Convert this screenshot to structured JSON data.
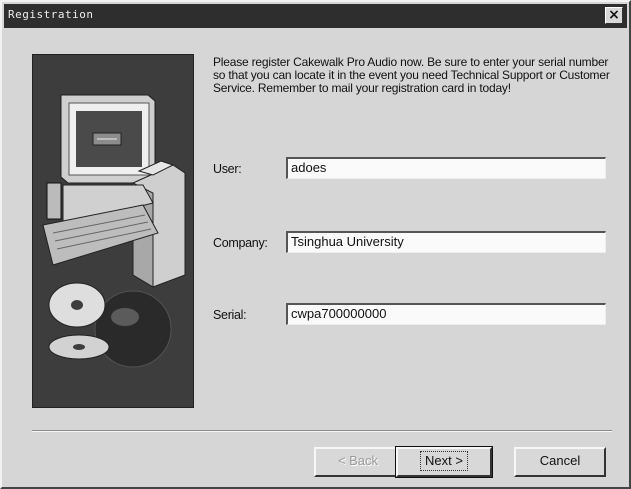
{
  "window": {
    "title": "Registration",
    "close_label": "×"
  },
  "intro_text": "Please register Cakewalk Pro Audio now.  Be sure to enter your serial number so that you can locate it in the event you need Technical Support or Customer Service.  Remember to mail your registration card in today!",
  "fields": {
    "user": {
      "label": "User:",
      "value": "adoes"
    },
    "company": {
      "label": "Company:",
      "value": "Tsinghua University"
    },
    "serial": {
      "label": "Serial:",
      "value": "cwpa700000000"
    }
  },
  "buttons": {
    "back": {
      "label": "< Back",
      "enabled": false
    },
    "next": {
      "label": "Next >",
      "enabled": true
    },
    "cancel": {
      "label": "Cancel",
      "enabled": true
    }
  },
  "colors": {
    "titlebar": "#2e2e2e",
    "dialog_face": "#d6d6d6",
    "image_panel": "#3b3b3b"
  },
  "icons": {
    "illustration": "computer-and-disc-illustration",
    "close": "close-icon"
  }
}
